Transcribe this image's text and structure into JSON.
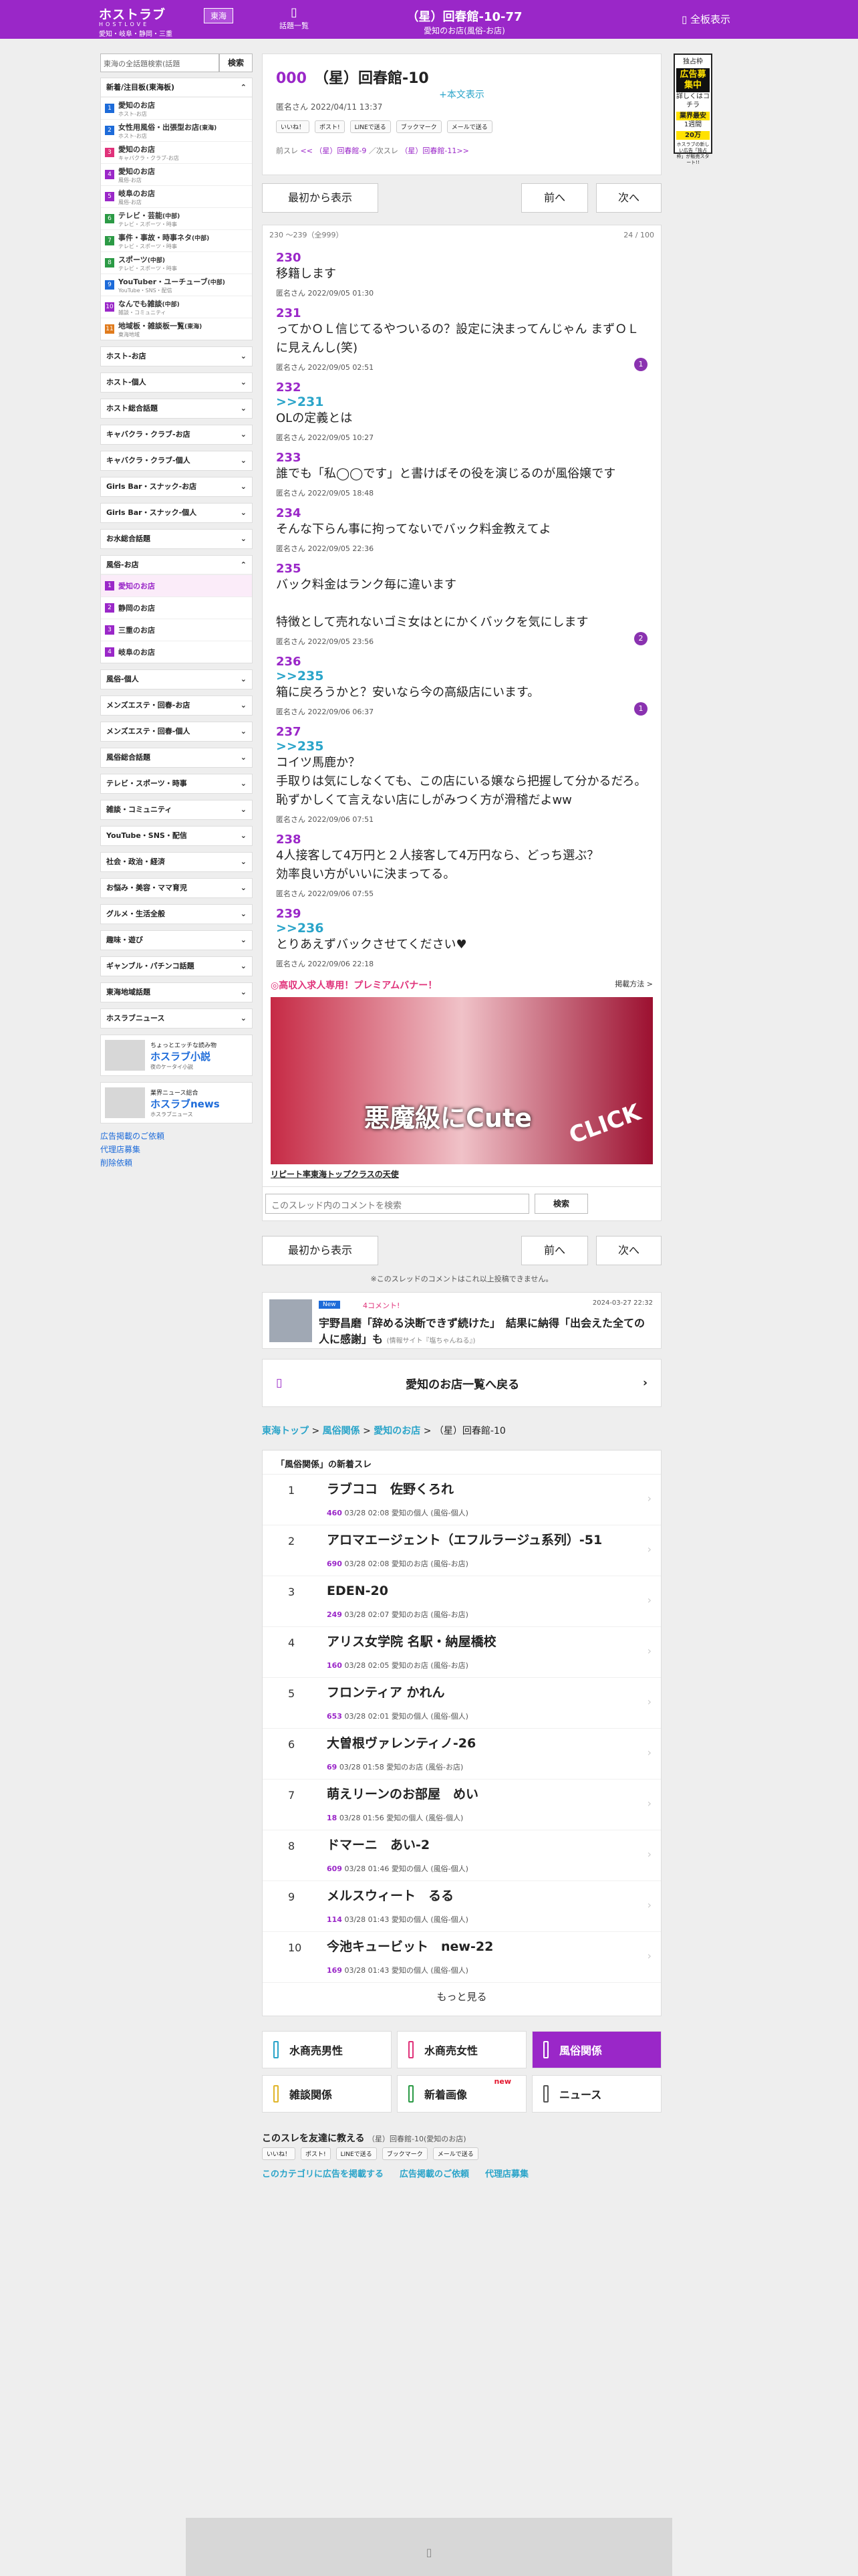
{
  "header": {
    "logo": "ホストラブ",
    "logo_en": "HOSTLOVE",
    "region": "愛知・岐阜・静岡・三重",
    "area_btn": "東海",
    "index_icon": "▯",
    "index_label": "話題一覧",
    "title": "（星）回春館-10-77",
    "subtitle": "愛知のお店(風俗-お店)",
    "all_label": "全板表示",
    "all_icon": "▯"
  },
  "ad": {
    "top": "独占枠",
    "main": "広告募集中",
    "sub": "詳しくはコチラ",
    "line1": "業界最安",
    "line2": "1週間",
    "price": "20万",
    "foot": "ホスラブの新しい広告「独占枠」が販売スタート!!"
  },
  "sidebar": {
    "search_placeholder": "東海の全話題検索(話題",
    "search_btn": "検索",
    "group1_title": "新着/注目板(東海板)",
    "group1_items": [
      {
        "n": "1",
        "l": "愛知のお店",
        "s": "ホスト-お店",
        "c": "#1d6bd9"
      },
      {
        "n": "2",
        "l": "女性用風俗・出張型お店",
        "lr": "(東海)",
        "s": "ホスト-お店",
        "c": "#1d6bd9"
      },
      {
        "n": "3",
        "l": "愛知のお店",
        "s": "キャバクラ・クラブ-お店",
        "c": "#e0327a"
      },
      {
        "n": "4",
        "l": "愛知のお店",
        "s": "風俗-お店",
        "c": "#9a27c8"
      },
      {
        "n": "5",
        "l": "岐阜のお店",
        "s": "風俗-お店",
        "c": "#9a27c8"
      },
      {
        "n": "6",
        "l": "テレビ・芸能",
        "lr": "(中部)",
        "s": "テレビ・スポーツ・時事",
        "c": "#2b9a45"
      },
      {
        "n": "7",
        "l": "事件・事故・時事ネタ",
        "lr": "(中部)",
        "s": "テレビ・スポーツ・時事",
        "c": "#2b9a45"
      },
      {
        "n": "8",
        "l": "スポーツ",
        "lr": "(中部)",
        "s": "テレビ・スポーツ・時事",
        "c": "#2b9a45"
      },
      {
        "n": "9",
        "l": "YouTuber・ユーチューブ",
        "lr": "(中部)",
        "s": "YouTube・SNS・配信",
        "c": "#1d6bd9"
      },
      {
        "n": "10",
        "l": "なんでも雑談",
        "lr": "(中部)",
        "s": "雑談・コミュニティ",
        "c": "#9a27c8"
      },
      {
        "n": "11",
        "l": "地域板・雑談板一覧",
        "lr": "(東海)",
        "s": "東海地域",
        "c": "#e07b1d"
      }
    ],
    "groups_a": [
      "ホスト-お店",
      "ホスト-個人",
      "ホスト総合話題",
      "キャバクラ・クラブ-お店",
      "キャバクラ・クラブ-個人",
      "Girls Bar・スナック-お店",
      "Girls Bar・スナック-個人",
      "お水総合話題"
    ],
    "fuzoku_title": "風俗-お店",
    "fuzoku_items": [
      {
        "n": "1",
        "l": "愛知のお店"
      },
      {
        "n": "2",
        "l": "静岡のお店"
      },
      {
        "n": "3",
        "l": "三重のお店"
      },
      {
        "n": "4",
        "l": "岐阜のお店"
      }
    ],
    "groups_b": [
      "風俗-個人",
      "メンズエステ・回春-お店",
      "メンズエステ・回春-個人",
      "風俗総合話題",
      "テレビ・スポーツ・時事",
      "雑談・コミュニティ",
      "YouTube・SNS・配信",
      "社会・政治・経済",
      "お悩み・美容・ママ育児",
      "グルメ・生活全般",
      "趣味・遊び",
      "ギャンブル・パチンコ話題",
      "東海地域話題",
      "ホスラブニュース"
    ],
    "banner1_top": "ちょっとエッチな読み物",
    "banner1": "ホスラブ小説",
    "banner1_sub": "夜のケータイ小説",
    "banner2_top": "業界ニュース総合",
    "banner2": "ホスラブnews",
    "banner2_sub": "ホスラブニュース",
    "links": [
      "広告掲載のご依頼",
      "代理店募集",
      "削除依頼"
    ]
  },
  "thread": {
    "no": "000",
    "title": "（星）回春館-10",
    "honbun": "+本文表示",
    "meta": "匿名さん 2022/04/11 13:37",
    "share": [
      "いいね！",
      "ポスト!",
      "LINEで送る",
      "ブックマーク",
      "メールで送る"
    ],
    "prev_label": "前スレ",
    "prev": "<< （星）回春館-9",
    "next_label": "次スレ",
    "next": "（星）回春館-11>>"
  },
  "nav": {
    "first": "最初から表示",
    "prev": "前へ",
    "next": "次へ",
    "range": "230 〜239（全999）",
    "count": "24 / 100"
  },
  "posts": [
    {
      "no": "230",
      "rep": "",
      "text": [
        "移籍します"
      ],
      "meta": "匿名さん 2022/09/05 01:30",
      "badge": ""
    },
    {
      "no": "231",
      "rep": "",
      "text": [
        "ってかＯＬ信じてるやついるの？設定に決まってんじゃん まずＯＬに見えんし(笑)"
      ],
      "meta": "匿名さん 2022/09/05 02:51",
      "badge": "1"
    },
    {
      "no": "232",
      "rep": ">>231",
      "text": [
        "OLの定義とは"
      ],
      "meta": "匿名さん 2022/09/05 10:27",
      "badge": ""
    },
    {
      "no": "233",
      "rep": "",
      "text": [
        "誰でも「私◯◯です」と書けばその役を演じるのが風俗嬢です"
      ],
      "meta": "匿名さん 2022/09/05 18:48",
      "badge": ""
    },
    {
      "no": "234",
      "rep": "",
      "text": [
        "そんな下らん事に拘ってないでバック料金教えてよ"
      ],
      "meta": "匿名さん 2022/09/05 22:36",
      "badge": ""
    },
    {
      "no": "235",
      "rep": "",
      "text": [
        "バック料金はランク毎に違います",
        "",
        "特徴として売れないゴミ女はとにかくバックを気にします"
      ],
      "meta": "匿名さん 2022/09/05 23:56",
      "badge": "2"
    },
    {
      "no": "236",
      "rep": ">>235",
      "text": [
        "箱に戻ろうかと？安いなら今の高級店にいます。"
      ],
      "meta": "匿名さん 2022/09/06 06:37",
      "badge": "1"
    },
    {
      "no": "237",
      "rep": ">>235",
      "text": [
        "コイツ馬鹿か？",
        "手取りは気にしなくても、この店にいる嬢なら把握して分かるだろ。",
        "恥ずかしくて言えない店にしがみつく方が滑稽だよww"
      ],
      "meta": "匿名さん 2022/09/06 07:51",
      "badge": ""
    },
    {
      "no": "238",
      "rep": "",
      "text": [
        "4人接客して4万円と２人接客して4万円なら、どっち選ぶ？",
        "効率良い方がいいに決まってる。"
      ],
      "meta": "匿名さん 2022/09/06 07:55",
      "badge": ""
    },
    {
      "no": "239",
      "rep": ">>236",
      "text": [
        "とりあえずバックさせてください♥"
      ],
      "meta": "匿名さん 2022/09/06 22:18",
      "badge": ""
    }
  ],
  "premium": {
    "title": "◎高収入求人専用！プレミアムバナー！",
    "right": "掲載方法 >",
    "c1": "悪魔級にCute",
    "c2": "CLICK",
    "caption": "リピート率東海トップクラスの天使"
  },
  "comment_search": {
    "placeholder": "このスレッド内のコメントを検索",
    "btn": "検索"
  },
  "note": "※このスレッドのコメントはこれ以上投稿できません。",
  "news": {
    "tag": "New",
    "comments": "4コメント!",
    "date": "2024-03-27 22:32",
    "title": "宇野昌磨「辞める決断できず続けた」　結果に納得「出会えた全ての人に感謝」も",
    "source": "(情報サイト『塩ちゃんねる』)"
  },
  "back": {
    "icon": "▯",
    "label": "愛知のお店一覧へ戻る",
    "arrow": "›"
  },
  "crumb": {
    "a": "東海トップ",
    "b": "風俗関係",
    "c": "愛知のお店",
    "d": "（星）回春館-10"
  },
  "threads": {
    "header": "「風俗関係」の新着スレ",
    "items": [
      {
        "i": "1",
        "t": "ラブココ　佐野くろれ",
        "c": "460",
        "d": "03/28 02:08",
        "b": "愛知の個人 (風俗-個人)"
      },
      {
        "i": "2",
        "t": "アロマエージェント（エフルラージュ系列）-51",
        "c": "690",
        "d": "03/28 02:08",
        "b": "愛知のお店 (風俗-お店)"
      },
      {
        "i": "3",
        "t": "EDEN-20",
        "c": "249",
        "d": "03/28 02:07",
        "b": "愛知のお店 (風俗-お店)"
      },
      {
        "i": "4",
        "t": "アリス女学院 名駅・納屋橋校",
        "c": "160",
        "d": "03/28 02:05",
        "b": "愛知のお店 (風俗-お店)"
      },
      {
        "i": "5",
        "t": "フロンティア かれん",
        "c": "653",
        "d": "03/28 02:01",
        "b": "愛知の個人 (風俗-個人)"
      },
      {
        "i": "6",
        "t": "大曽根ヴァレンティノ-26",
        "c": "69",
        "d": "03/28 01:58",
        "b": "愛知のお店 (風俗-お店)"
      },
      {
        "i": "7",
        "t": "萌えリーンのお部屋　めい",
        "c": "18",
        "d": "03/28 01:56",
        "b": "愛知の個人 (風俗-個人)"
      },
      {
        "i": "8",
        "t": "ドマーニ　あい-2",
        "c": "609",
        "d": "03/28 01:46",
        "b": "愛知の個人 (風俗-個人)"
      },
      {
        "i": "9",
        "t": "メルスウィート　るる",
        "c": "114",
        "d": "03/28 01:43",
        "b": "愛知の個人 (風俗-個人)"
      },
      {
        "i": "10",
        "t": "今池キュービット　new-22",
        "c": "169",
        "d": "03/28 01:43",
        "b": "愛知の個人 (風俗-個人)"
      }
    ],
    "more": "もっと見る"
  },
  "cats": [
    {
      "l": "水商売男性",
      "c": "#2aa4c9"
    },
    {
      "l": "水商売女性",
      "c": "#e0327a"
    },
    {
      "l": "風俗関係",
      "c": "#fff",
      "on": true
    },
    {
      "l": "雑談関係",
      "c": "#e0b52a"
    },
    {
      "l": "新着画像",
      "c": "#2b9a45",
      "nw": "new"
    },
    {
      "l": "ニュース",
      "c": "#555"
    }
  ],
  "share_bottom": {
    "label": "このスレを友達に教える",
    "thread": "（星）回春館-10(愛知のお店)",
    "links": [
      "このカテゴリに広告を掲載する",
      "広告掲載のご依頼",
      "代理店募集"
    ]
  },
  "footer_icon": "▯"
}
